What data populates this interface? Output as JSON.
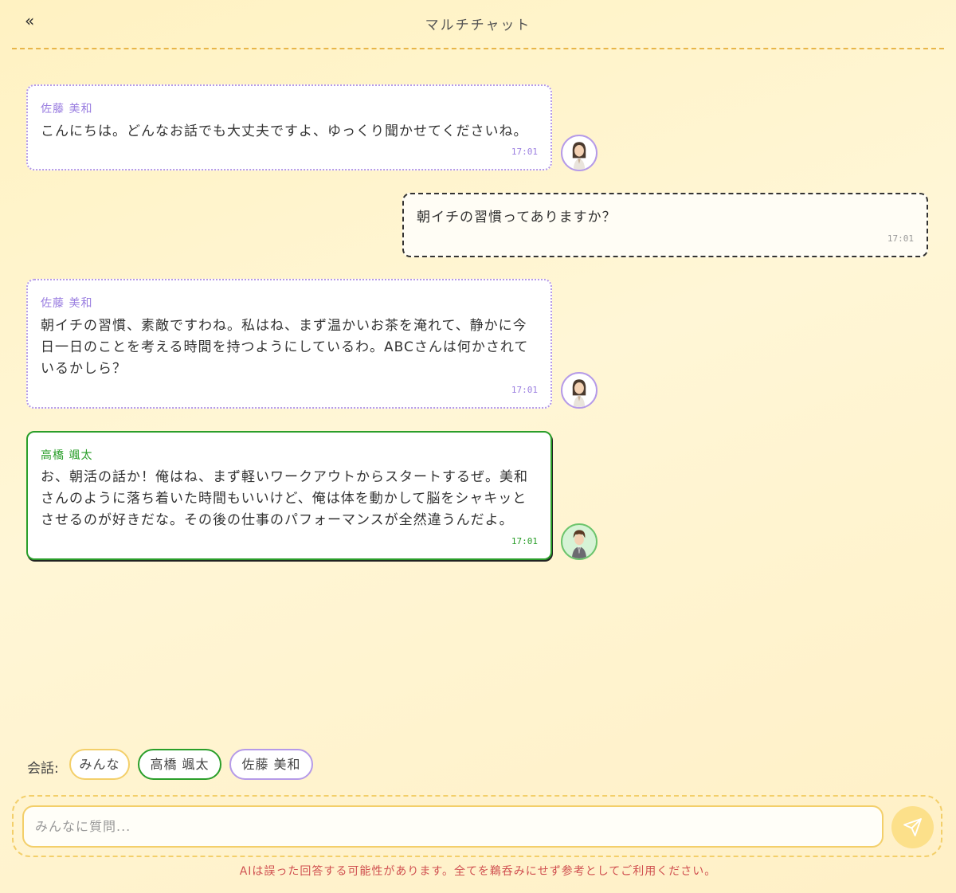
{
  "header": {
    "back_label": "«",
    "title": "マルチチャット"
  },
  "messages": [
    {
      "sender": "佐藤 美和",
      "text": "こんにちは。どんなお話でも大丈夫ですよ、ゆっくり聞かせてくださいね。",
      "time": "17:01"
    },
    {
      "sender": "",
      "text": "朝イチの習慣ってありますか？",
      "time": "17:01"
    },
    {
      "sender": "佐藤 美和",
      "text": "朝イチの習慣、素敵ですわね。私はね、まず温かいお茶を淹れて、静かに今日一日のことを考える時間を持つようにしているわ。ABCさんは何かされているかしら？",
      "time": "17:01"
    },
    {
      "sender": "高橋 颯太",
      "text": "お、朝活の話か！俺はね、まず軽いワークアウトからスタートするぜ。美和さんのように落ち着いた時間もいいけど、俺は体を動かして脳をシャキッとさせるのが好きだな。その後の仕事のパフォーマンスが全然違うんだよ。",
      "time": "17:01"
    }
  ],
  "conversation": {
    "label": "会話:",
    "chips": [
      "みんな",
      "高橋 颯太",
      "佐藤 美和"
    ]
  },
  "input": {
    "placeholder": "みんなに質問..."
  },
  "disclaimer": "AIは誤った回答する可能性があります。全てを鵜呑みにせず参考としてご利用ください。",
  "colors": {
    "sato": "#b59ae8",
    "takahashi": "#2a9e2a",
    "accent": "#f3cf6a",
    "disclaimer": "#d05050"
  }
}
